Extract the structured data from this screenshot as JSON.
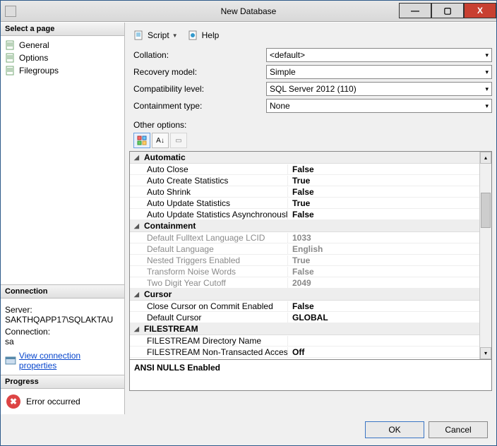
{
  "titlebar": {
    "title": "New Database"
  },
  "winbuttons": {
    "min": "—",
    "max": "▢",
    "close": "X"
  },
  "sidebar": {
    "select_page": "Select a page",
    "items": [
      {
        "label": "General"
      },
      {
        "label": "Options"
      },
      {
        "label": "Filegroups"
      }
    ]
  },
  "connection": {
    "heading": "Connection",
    "server_label": "Server:",
    "server_value": "SAKTHQAPP17\\SQLAKTAU",
    "conn_label": "Connection:",
    "conn_value": "sa",
    "view_link": "View connection properties"
  },
  "progress": {
    "heading": "Progress",
    "status": "Error occurred"
  },
  "toolbar": {
    "script": "Script",
    "help": "Help"
  },
  "form": {
    "collation_label": "Collation:",
    "collation_value": "<default>",
    "recovery_label": "Recovery model:",
    "recovery_value": "Simple",
    "compat_label": "Compatibility level:",
    "compat_value": "SQL Server 2012 (110)",
    "containment_label": "Containment type:",
    "containment_value": "None",
    "other_label": "Other options:"
  },
  "grid": {
    "sections": [
      {
        "title": "Automatic",
        "rows": [
          {
            "k": "Auto Close",
            "v": "False"
          },
          {
            "k": "Auto Create Statistics",
            "v": "True"
          },
          {
            "k": "Auto Shrink",
            "v": "False"
          },
          {
            "k": "Auto Update Statistics",
            "v": "True"
          },
          {
            "k": "Auto Update Statistics Asynchronously",
            "v": "False"
          }
        ]
      },
      {
        "title": "Containment",
        "dim": true,
        "rows": [
          {
            "k": "Default Fulltext Language LCID",
            "v": "1033"
          },
          {
            "k": "Default Language",
            "v": "English"
          },
          {
            "k": "Nested Triggers Enabled",
            "v": "True"
          },
          {
            "k": "Transform Noise Words",
            "v": "False"
          },
          {
            "k": "Two Digit Year Cutoff",
            "v": "2049"
          }
        ]
      },
      {
        "title": "Cursor",
        "rows": [
          {
            "k": "Close Cursor on Commit Enabled",
            "v": "False"
          },
          {
            "k": "Default Cursor",
            "v": "GLOBAL"
          }
        ]
      },
      {
        "title": "FILESTREAM",
        "rows": [
          {
            "k": "FILESTREAM Directory Name",
            "v": ""
          },
          {
            "k": "FILESTREAM Non-Transacted Access",
            "v": "Off"
          }
        ]
      }
    ],
    "description": "ANSI NULLS Enabled"
  },
  "buttons": {
    "ok": "OK",
    "cancel": "Cancel"
  }
}
